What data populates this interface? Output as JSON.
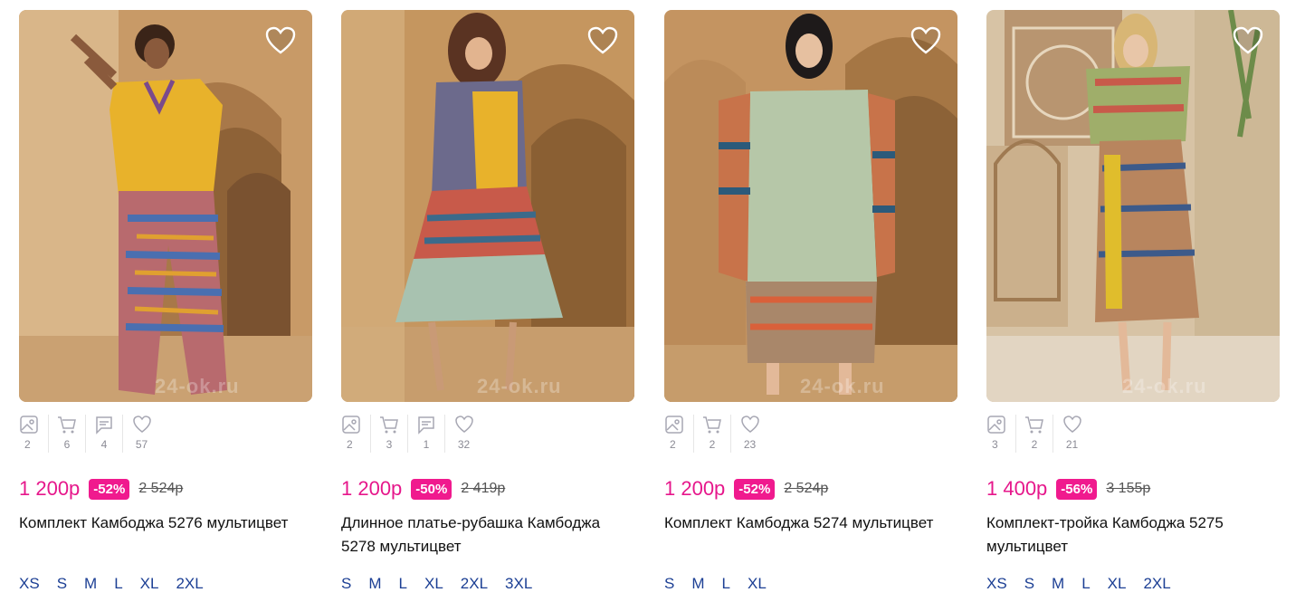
{
  "products": [
    {
      "title": "Комплект Камбоджа 5276 мультицвет",
      "price": "1 200р",
      "discount": "-52%",
      "old_price": "2 524р",
      "stats": {
        "photos": "2",
        "carts": "6",
        "reviews": "4",
        "likes": "57"
      },
      "sizes": [
        "XS",
        "S",
        "M",
        "L",
        "XL",
        "2XL"
      ],
      "watermark": "24-ok.ru"
    },
    {
      "title": "Длинное платье-рубашка Камбоджа 5278 мультицвет",
      "price": "1 200р",
      "discount": "-50%",
      "old_price": "2 419р",
      "stats": {
        "photos": "2",
        "carts": "3",
        "reviews": "1",
        "likes": "32"
      },
      "sizes": [
        "S",
        "M",
        "L",
        "XL",
        "2XL",
        "3XL"
      ],
      "watermark": "24-ok.ru"
    },
    {
      "title": "Комплект Камбоджа 5274 мультицвет",
      "price": "1 200р",
      "discount": "-52%",
      "old_price": "2 524р",
      "stats": {
        "photos": "2",
        "carts": "2",
        "likes": "23"
      },
      "sizes": [
        "S",
        "M",
        "L",
        "XL"
      ],
      "watermark": "24-ok.ru"
    },
    {
      "title": "Комплект-тройка Камбоджа 5275 мультицвет",
      "price": "1 400р",
      "discount": "-56%",
      "old_price": "3 155р",
      "stats": {
        "photos": "3",
        "carts": "2",
        "likes": "21"
      },
      "sizes": [
        "XS",
        "S",
        "M",
        "L",
        "XL",
        "2XL"
      ],
      "watermark": "24-ok.ru"
    }
  ],
  "colors": {
    "price": "#e6178b",
    "discount_bg": "#f01a8e",
    "size_link": "#1c3f94",
    "stat_icon": "#a7a7b3"
  },
  "icons": {
    "favorite": "heart-outline-icon",
    "photos": "image-icon",
    "carts": "cart-icon",
    "reviews": "comment-icon",
    "likes": "heart-icon"
  }
}
